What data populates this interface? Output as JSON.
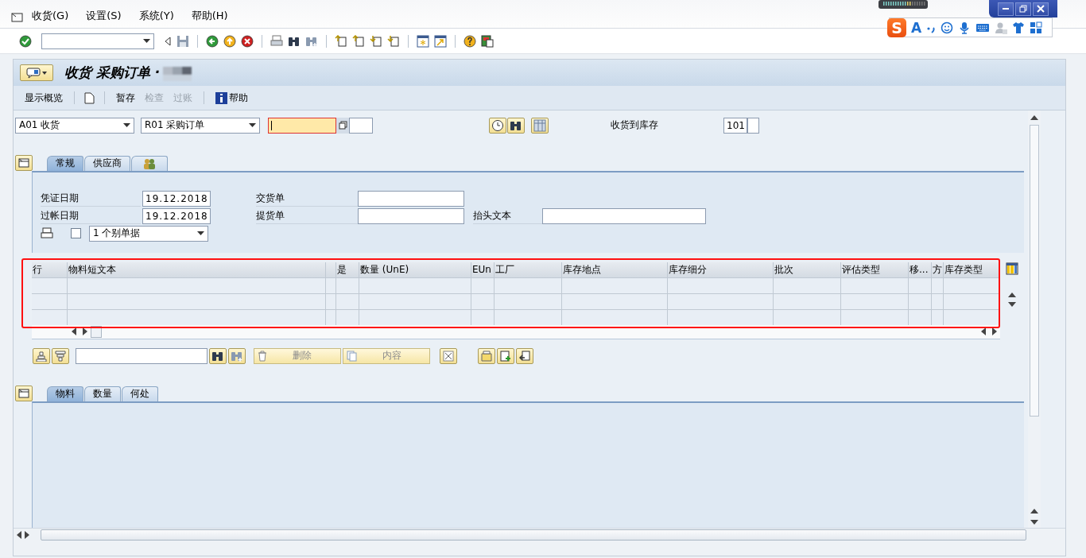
{
  "menu": [
    {
      "label": "收货(G)"
    },
    {
      "label": "设置(S)"
    },
    {
      "label": "系统(Y)"
    },
    {
      "label": "帮助(H)"
    }
  ],
  "ime": {
    "logo": "S",
    "mode": "A"
  },
  "title": "收货 采购订单 ·",
  "app_toolbar": [
    {
      "kind": "text",
      "label": "显示概览",
      "disabled": false
    },
    {
      "kind": "separator"
    },
    {
      "kind": "new"
    },
    {
      "kind": "separator"
    },
    {
      "kind": "text",
      "label": "暂存",
      "disabled": false
    },
    {
      "kind": "text",
      "label": "检查",
      "disabled": true
    },
    {
      "kind": "text",
      "label": "过账",
      "disabled": true
    },
    {
      "kind": "separator"
    },
    {
      "kind": "info",
      "label": "帮助",
      "disabled": false
    }
  ],
  "header": {
    "action": "A01 收货",
    "reference": "R01 采购订单",
    "movement_label": "收货到库存",
    "movement_type": "101"
  },
  "tabs": [
    {
      "kind": "text",
      "label": "常规",
      "selected": true
    },
    {
      "kind": "text",
      "label": "供应商",
      "selected": false
    },
    {
      "kind": "icon",
      "selected": false
    }
  ],
  "fields": [
    {
      "label": "凭证日期",
      "value": "19.12.2018"
    },
    {
      "label": "过帐日期",
      "value": "19.12.2018"
    },
    {
      "label": "交货单"
    },
    {
      "label": "提货单"
    },
    {
      "label": "抬头文本"
    }
  ],
  "print": {
    "checked": false,
    "mode": "1 个别单据"
  },
  "table": {
    "columns": [
      {
        "kind": "text",
        "label": "行"
      },
      {
        "kind": "text",
        "label": "物料短文本"
      },
      {
        "kind": "cut"
      },
      {
        "kind": "text",
        "label": "是"
      },
      {
        "kind": "text",
        "label": "数量 (UnE)"
      },
      {
        "kind": "text",
        "label": "EUn"
      },
      {
        "kind": "text",
        "label": "工厂"
      },
      {
        "kind": "text",
        "label": "库存地点"
      },
      {
        "kind": "text",
        "label": "库存细分"
      },
      {
        "kind": "text",
        "label": "批次"
      },
      {
        "kind": "text",
        "label": "评估类型"
      },
      {
        "kind": "text",
        "label": "移..."
      },
      {
        "kind": "text",
        "label": "方"
      },
      {
        "kind": "text",
        "label": "库存类型"
      }
    ]
  },
  "table_buttons": [
    {
      "kind": "delete",
      "label": "删除"
    },
    {
      "kind": "copy",
      "label": "内容"
    }
  ],
  "detail_tabs": [
    {
      "label": "物料",
      "selected": true
    },
    {
      "label": "数量",
      "selected": false
    },
    {
      "label": "何处",
      "selected": false
    }
  ]
}
